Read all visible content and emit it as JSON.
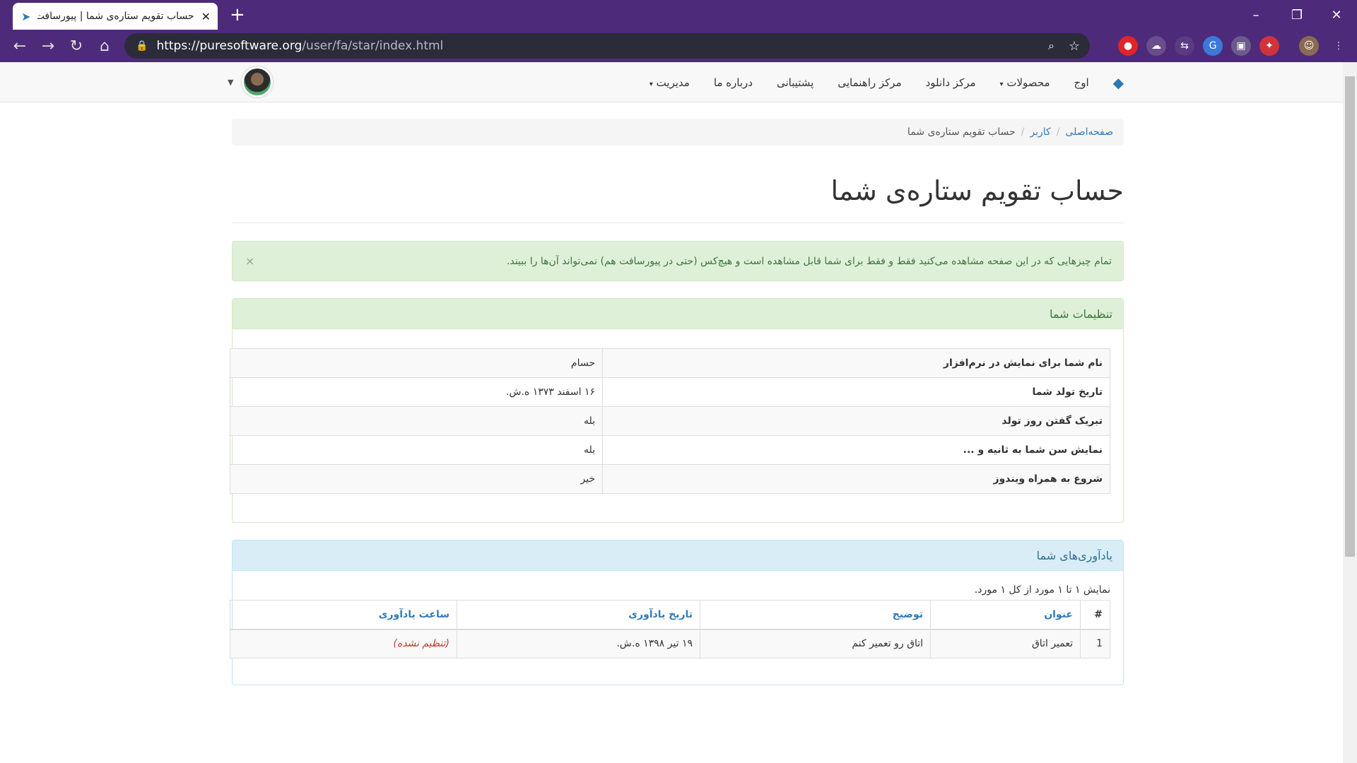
{
  "browser": {
    "tab_title": "حساب تقویم ستاره‌ی شما | پیورسافت",
    "url_host": "https://puresoftware.org",
    "url_path": "/user/fa/star/index.html",
    "accent": "#4e2a7a"
  },
  "nav": {
    "brand": "اوج",
    "items": [
      "محصولات",
      "مرکز دانلود",
      "مرکز راهنمایی",
      "پشتیبانی",
      "درباره ما",
      "مدیریت"
    ]
  },
  "breadcrumb": {
    "home": "صفحه‌اصلی",
    "user": "کاربر",
    "current": "حساب تقویم ستاره‌ی شما"
  },
  "page": {
    "title": "حساب تقویم ستاره‌ی شما",
    "alert": "تمام چیزهایی که در این صفحه مشاهده می‌کنید فقط و فقط برای شما قابل مشاهده است و هیچ‌کس (حتی در پیورسافت هم) نمی‌تواند آن‌ها را ببیند."
  },
  "settings": {
    "heading": "تنظیمات شما",
    "rows": [
      {
        "key": "نام شما برای نمایش در نرم‌افزار",
        "value": "حسام"
      },
      {
        "key": "تاریخ تولد شما",
        "value": "۱۶ اسفند ۱۳۷۳ ه.ش."
      },
      {
        "key": "تبریک گفتن روز تولد",
        "value": "بله"
      },
      {
        "key": "نمایش سن شما به ثانیه و ...",
        "value": "بله"
      },
      {
        "key": "شروع به همراه ویندوز",
        "value": "خیر"
      }
    ]
  },
  "reminders": {
    "heading": "یادآوری‌های شما",
    "count_text": "نمایش ۱ تا ۱ مورد از کل ۱ مورد.",
    "columns": [
      "#",
      "عنوان",
      "توضیح",
      "تاریخ یادآوری",
      "ساعت یادآوری"
    ],
    "rows": [
      {
        "num": "1",
        "title": "تعمیر اتاق",
        "desc": "اتاق رو تعمیر کنم",
        "date": "۱۹ تیر ۱۳۹۸ ه.ش.",
        "time": "(تنظیم نشده)"
      }
    ]
  }
}
